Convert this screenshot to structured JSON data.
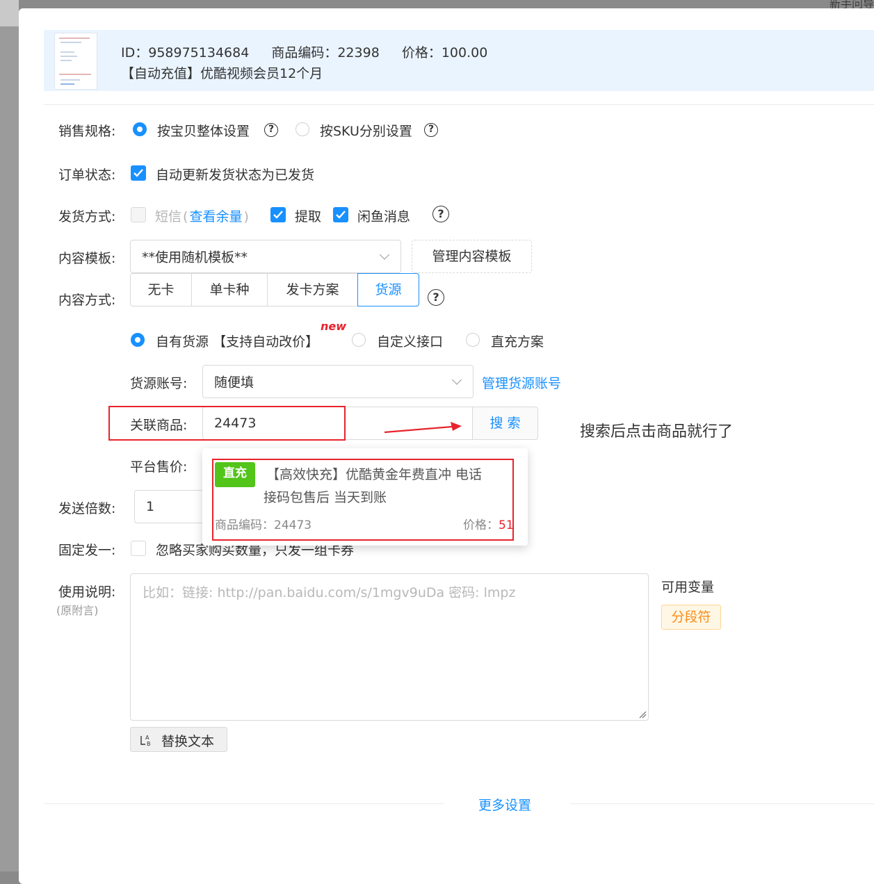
{
  "background": {
    "top_right_text": "新手问导"
  },
  "product": {
    "id_text": "ID：958975134684",
    "code_text": "商品编码：22398",
    "price_text": "价格：100.00",
    "title": "【自动充值】优酷视频会员12个月"
  },
  "sales_spec": {
    "label": "销售规格:",
    "option1": "按宝贝整体设置",
    "option2": "按SKU分别设置",
    "selected": "按宝贝整体设置"
  },
  "order_status": {
    "label": "订单状态:",
    "checkbox_label": "自动更新发货状态为已发货",
    "checked": true
  },
  "delivery": {
    "label": "发货方式:",
    "sms_label": "短信",
    "sms_paren_open": "(",
    "sms_link": "查看余量",
    "sms_paren_close": ")",
    "extract_label": "提取",
    "xianyu_label": "闲鱼消息"
  },
  "template": {
    "label": "内容模板:",
    "value": "**使用随机模板**",
    "manage_button": "管理内容模板"
  },
  "content_mode": {
    "label": "内容方式:",
    "tabs": [
      "无卡",
      "单卡种",
      "发卡方案",
      "货源"
    ],
    "active_tab": "货源"
  },
  "source_type": {
    "option1": "自有货源",
    "option1_note": "【支持自动改价】",
    "new_badge": "new",
    "option2": "自定义接口",
    "option3": "直充方案",
    "selected": "自有货源"
  },
  "source_account": {
    "label": "货源账号:",
    "value": "随便填",
    "manage_link": "管理货源账号"
  },
  "linked_product": {
    "label": "关联商品:",
    "value": "24473",
    "search_button": "搜 索"
  },
  "annotation": {
    "text": "搜索后点击商品就行了",
    "color": "#e8232c"
  },
  "platform_price": {
    "label": "平台售价:"
  },
  "dropdown_result": {
    "tag": "直充",
    "title_line1": "【高效快充】优酷黄金年费直冲 电话",
    "title_line2": "接码包售后 当天到账",
    "code": "商品编码：24473",
    "price_label": "价格：",
    "price_value": "51"
  },
  "send_multiplier": {
    "label": "发送倍数:",
    "value": "1"
  },
  "fixed_one": {
    "label": "固定发一:",
    "checkbox_label": "忽略买家购买数量，只发一组卡券"
  },
  "usage": {
    "label": "使用说明:",
    "sublabel": "(原附言)",
    "placeholder": "比如：链接: http://pan.baidu.com/s/1mgv9uDa 密码: lmpz",
    "available_vars": "可用变量",
    "var_tag": "分段符",
    "replace_button": "替换文本"
  },
  "more_settings": "更多设置",
  "colors": {
    "primary": "#1890ff",
    "green": "#52c41a",
    "red": "#e8232c",
    "orange": "#fa8c16",
    "header_bg": "#eaf4ff"
  }
}
